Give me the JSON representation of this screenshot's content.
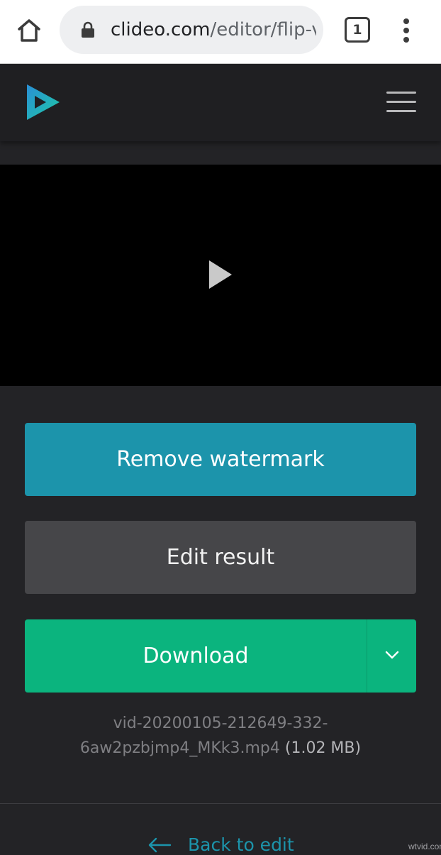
{
  "browser": {
    "url_domain": "clideo.com",
    "url_path": "/editor/flip-v",
    "tab_count": "1",
    "icons": [
      "home-icon",
      "lock-icon",
      "tabs-icon",
      "more-vert-icon"
    ]
  },
  "header": {
    "logo_icon": "clideo-play-logo",
    "menu_icon": "hamburger-icon"
  },
  "video": {
    "play_icon": "play-icon"
  },
  "actions": {
    "remove_watermark_label": "Remove watermark",
    "edit_result_label": "Edit result",
    "download_label": "Download",
    "dropdown_icon": "chevron-down-icon"
  },
  "file": {
    "name_line1": "vid-20200105-212649-332-",
    "name_line2": "6aw2pzbjmp4_MKk3.mp4",
    "size": "(1.02 MB)"
  },
  "footer": {
    "back_label": "Back to edit",
    "back_icon": "arrow-left-icon"
  },
  "watermark": "wtvid.com",
  "colors": {
    "accent_blue": "#1c94ab",
    "download_green": "#0bb47e",
    "edit_gray": "#464649",
    "background": "#232326",
    "logo_teal": "#1ec8a5",
    "logo_blue": "#2a8fd6"
  }
}
